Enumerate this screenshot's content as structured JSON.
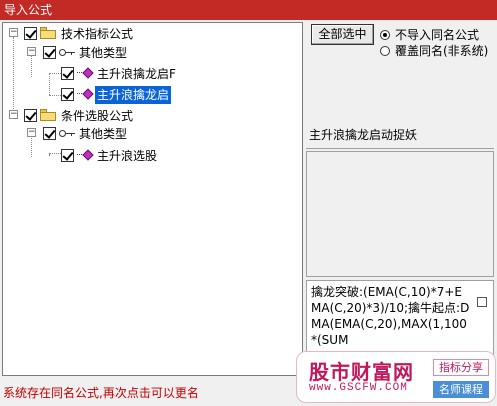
{
  "window": {
    "title": "导入公式"
  },
  "tree": {
    "root1": {
      "label": "技术指标公式",
      "group": {
        "label": "其他类型",
        "items": [
          {
            "label": "主升浪擒龙启F",
            "selected": false
          },
          {
            "label": "主升浪擒龙启",
            "selected": true
          }
        ]
      }
    },
    "root2": {
      "label": "条件选股公式",
      "group": {
        "label": "其他类型",
        "items": [
          {
            "label": "主升浪选股",
            "selected": false
          }
        ]
      }
    }
  },
  "actions": {
    "select_all_label": "全部选中",
    "options": [
      {
        "label": "不导入同名公式",
        "checked": true
      },
      {
        "label": "覆盖同名(非系统)",
        "checked": false
      }
    ]
  },
  "description": "主升浪擒龙启动捉妖",
  "formula_preview": "擒龙突破:(EMA(C,10)*7+EMA(C,20)*3)/10;擒牛起点:DMA(EMA(C,20),MAX(1,100*(SUM",
  "status_message": "系统存在同名公式,再次点击可以更名",
  "watermark": {
    "name": "股市财富网",
    "url": "www.GSCFW.COM",
    "tag1": "指标分享",
    "tag2": "名师课程"
  },
  "colors": {
    "title_bar": "#c22a26",
    "selection": "#0a64d8",
    "status_text": "#c00000",
    "watermark": "#c2185b"
  }
}
